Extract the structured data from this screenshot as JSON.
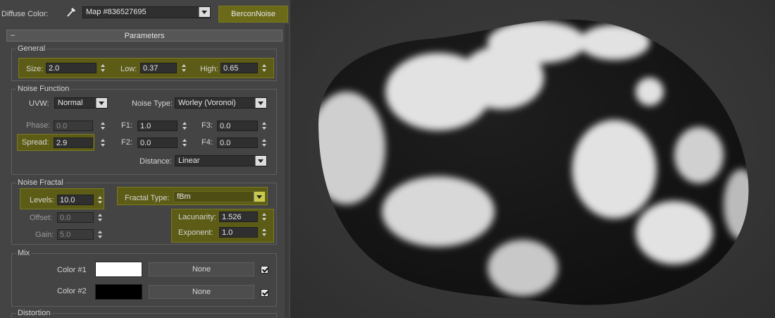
{
  "header": {
    "diffuse_label": "Diffuse Color:",
    "map_name": "Map #836527695",
    "map_type": "BerconNoise"
  },
  "rollout": {
    "collapse_symbol": "–",
    "title": "Parameters"
  },
  "general": {
    "title": "General",
    "size_label": "Size:",
    "size_value": "2.0",
    "low_label": "Low:",
    "low_value": "0.37",
    "high_label": "High:",
    "high_value": "0.65"
  },
  "noise_function": {
    "title": "Noise Function",
    "uvw_label": "UVW:",
    "uvw_value": "Normal",
    "noise_type_label": "Noise Type:",
    "noise_type_value": "Worley (Voronoi)",
    "phase_label": "Phase:",
    "phase_value": "0.0",
    "spread_label": "Spread:",
    "spread_value": "2.9",
    "f1_label": "F1:",
    "f1_value": "1.0",
    "f2_label": "F2:",
    "f2_value": "0.0",
    "f3_label": "F3:",
    "f3_value": "0.0",
    "f4_label": "F4:",
    "f4_value": "0.0",
    "distance_label": "Distance:",
    "distance_value": "Linear"
  },
  "noise_fractal": {
    "title": "Noise Fractal",
    "levels_label": "Levels:",
    "levels_value": "10.0",
    "offset_label": "Offset:",
    "offset_value": "0.0",
    "gain_label": "Gain:",
    "gain_value": "5.0",
    "fractal_type_label": "Fractal Type:",
    "fractal_type_value": "fBm",
    "lacunarity_label": "Lacunarity:",
    "lacunarity_value": "1.526",
    "exponent_label": "Exponent:",
    "exponent_value": "1.0"
  },
  "mix": {
    "title": "Mix",
    "color1_label": "Color #1",
    "color1_swatch": "#ffffff",
    "color1_map": "None",
    "color2_label": "Color #2",
    "color2_swatch": "#000000",
    "color2_map": "None"
  },
  "distortion": {
    "title": "Distortion"
  },
  "colors": {
    "highlight": "#5c5c16",
    "panel_bg": "#444444",
    "viewport_bg": "#343434"
  },
  "icons": {
    "eyedropper": "eyedropper-icon",
    "spinner": "spinner-icon",
    "dropdown": "chevron-down-icon",
    "checkbox": "checkmark-icon"
  }
}
